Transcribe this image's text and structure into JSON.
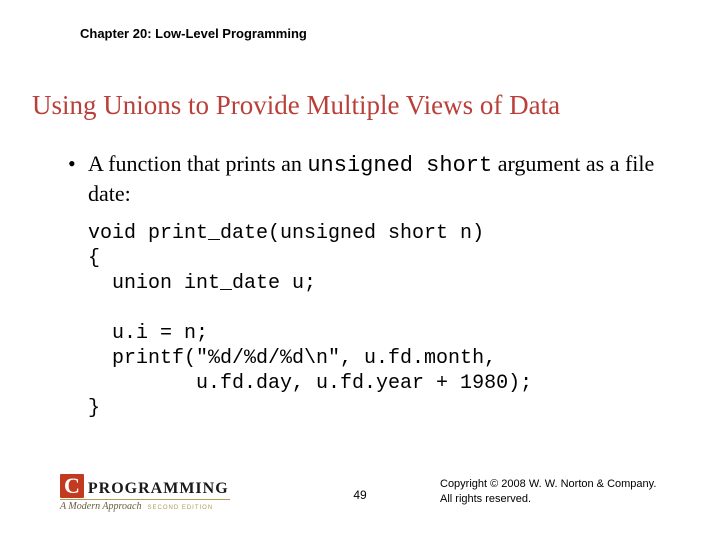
{
  "chapter": "Chapter 20: Low-Level Programming",
  "title": "Using Unions to Provide Multiple Views of Data",
  "bullet": {
    "pre": "A function that prints an ",
    "code": "unsigned short",
    "post": " argument as a file date:"
  },
  "code": "void print_date(unsigned short n)\n{\n  union int_date u;\n\n  u.i = n;\n  printf(\"%d/%d/%d\\n\", u.fd.month,\n         u.fd.day, u.fd.year + 1980);\n}",
  "logo": {
    "c": "C",
    "prog": "PROGRAMMING",
    "sub": "A Modern Approach",
    "edition": "SECOND EDITION"
  },
  "pagenum": "49",
  "copyright_line1": "Copyright © 2008 W. W. Norton & Company.",
  "copyright_line2": "All rights reserved."
}
